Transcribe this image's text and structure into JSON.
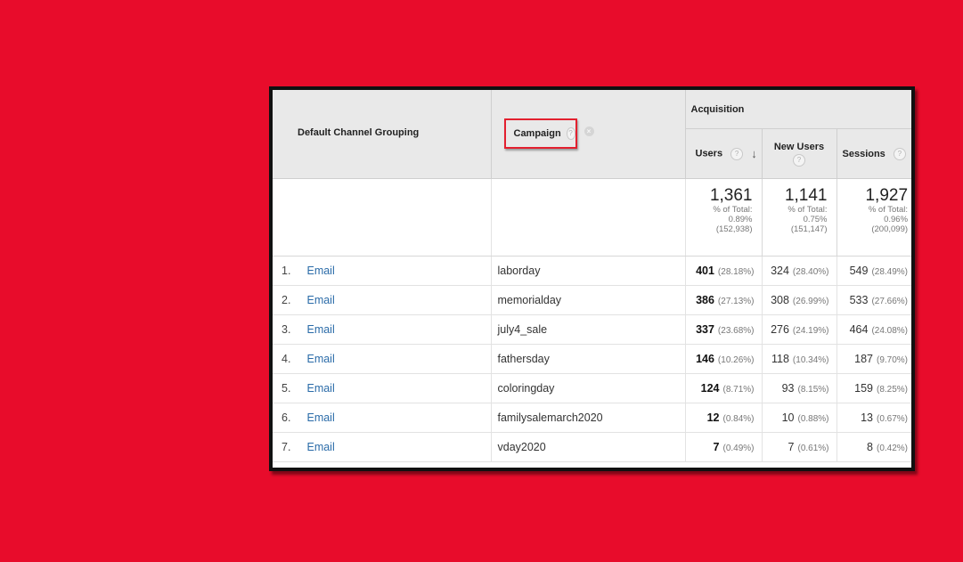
{
  "table": {
    "header": {
      "dimension_1": "Default Channel Grouping",
      "dimension_2": "Campaign",
      "help_glyph": "?",
      "remove_glyph": "×",
      "sort_glyph": "↓",
      "group": "Acquisition",
      "metrics": [
        "Users",
        "New Users",
        "Sessions"
      ]
    },
    "totals": [
      {
        "value": "1,361",
        "label": "% of Total:",
        "pct": "0.89%",
        "total": "(152,938)"
      },
      {
        "value": "1,141",
        "label": "% of Total:",
        "pct": "0.75%",
        "total": "(151,147)"
      },
      {
        "value": "1,927",
        "label": "% of Total:",
        "pct": "0.96%",
        "total": "(200,099)"
      }
    ],
    "rows": [
      {
        "index": "1.",
        "channel": "Email",
        "campaign": "laborday",
        "users": "401",
        "users_pct": "(28.18%)",
        "new_users": "324",
        "new_users_pct": "(28.40%)",
        "sessions": "549",
        "sessions_pct": "(28.49%)"
      },
      {
        "index": "2.",
        "channel": "Email",
        "campaign": "memorialday",
        "users": "386",
        "users_pct": "(27.13%)",
        "new_users": "308",
        "new_users_pct": "(26.99%)",
        "sessions": "533",
        "sessions_pct": "(27.66%)"
      },
      {
        "index": "3.",
        "channel": "Email",
        "campaign": "july4_sale",
        "users": "337",
        "users_pct": "(23.68%)",
        "new_users": "276",
        "new_users_pct": "(24.19%)",
        "sessions": "464",
        "sessions_pct": "(24.08%)"
      },
      {
        "index": "4.",
        "channel": "Email",
        "campaign": "fathersday",
        "users": "146",
        "users_pct": "(10.26%)",
        "new_users": "118",
        "new_users_pct": "(10.34%)",
        "sessions": "187",
        "sessions_pct": "(9.70%)"
      },
      {
        "index": "5.",
        "channel": "Email",
        "campaign": "coloringday",
        "users": "124",
        "users_pct": "(8.71%)",
        "new_users": "93",
        "new_users_pct": "(8.15%)",
        "sessions": "159",
        "sessions_pct": "(8.25%)"
      },
      {
        "index": "6.",
        "channel": "Email",
        "campaign": "familysalemarch2020",
        "users": "12",
        "users_pct": "(0.84%)",
        "new_users": "10",
        "new_users_pct": "(0.88%)",
        "sessions": "13",
        "sessions_pct": "(0.67%)"
      },
      {
        "index": "7.",
        "channel": "Email",
        "campaign": "vday2020",
        "users": "7",
        "users_pct": "(0.49%)",
        "new_users": "7",
        "new_users_pct": "(0.61%)",
        "sessions": "8",
        "sessions_pct": "(0.42%)"
      }
    ]
  },
  "colors": {
    "background": "#e80c2b",
    "highlight_box": "#e3202f",
    "link": "#2a6ba8",
    "header_bg": "#e9e9e9"
  },
  "icons": {
    "help": "help-icon",
    "remove": "remove-dimension-icon",
    "sort": "sort-desc-icon"
  }
}
